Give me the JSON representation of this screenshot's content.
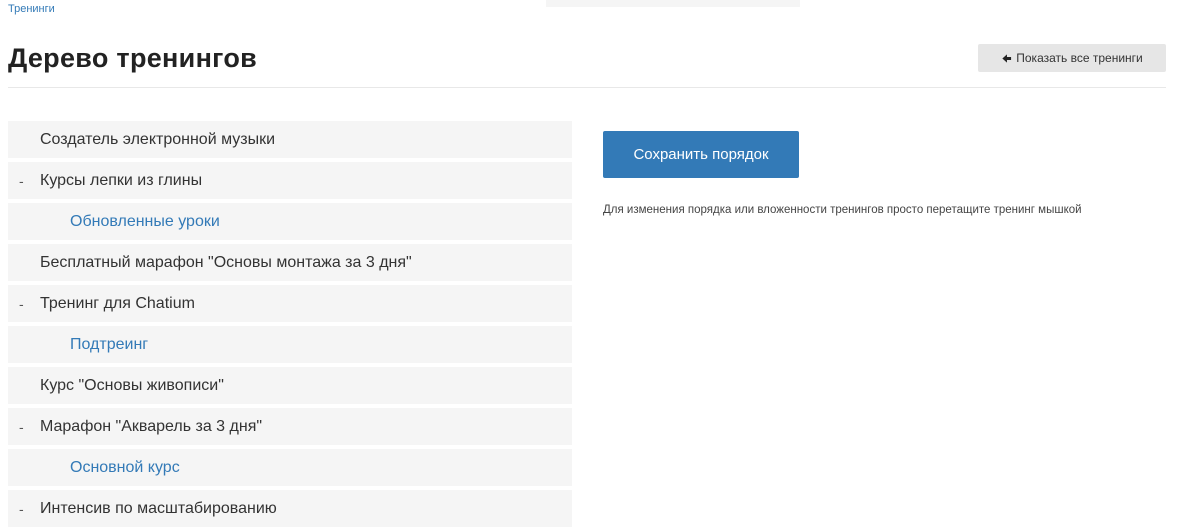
{
  "breadcrumb": {
    "label": "Тренинги"
  },
  "header": {
    "title": "Дерево тренингов",
    "show_all_label": "Показать все тренинги"
  },
  "tree": {
    "items": [
      {
        "label": "Создатель электронной музыки",
        "level": 0,
        "toggle": ""
      },
      {
        "label": "Курсы лепки из глины",
        "level": 0,
        "toggle": "-"
      },
      {
        "label": "Обновленные уроки",
        "level": 1,
        "toggle": ""
      },
      {
        "label": "Бесплатный марафон \"Основы монтажа за 3 дня\"",
        "level": 0,
        "toggle": ""
      },
      {
        "label": "Тренинг для Chatium",
        "level": 0,
        "toggle": "-"
      },
      {
        "label": "Подтреинг",
        "level": 1,
        "toggle": ""
      },
      {
        "label": "Курс \"Основы живописи\"",
        "level": 0,
        "toggle": ""
      },
      {
        "label": "Марафон \"Акварель за 3 дня\"",
        "level": 0,
        "toggle": "-"
      },
      {
        "label": "Основной курс",
        "level": 1,
        "toggle": ""
      },
      {
        "label": "Интенсив по масштабированию",
        "level": 0,
        "toggle": "-"
      }
    ]
  },
  "actions": {
    "save_order_label": "Сохранить порядок",
    "hint": "Для изменения порядка или вложенности тренингов просто перетащите тренинг мышкой"
  },
  "colors": {
    "link": "#337ab7",
    "primary_button": "#337ab7",
    "row_background": "#f5f5f5",
    "secondary_button": "#e6e6e6"
  },
  "icons": {
    "show_all": "arrow-left-icon"
  }
}
